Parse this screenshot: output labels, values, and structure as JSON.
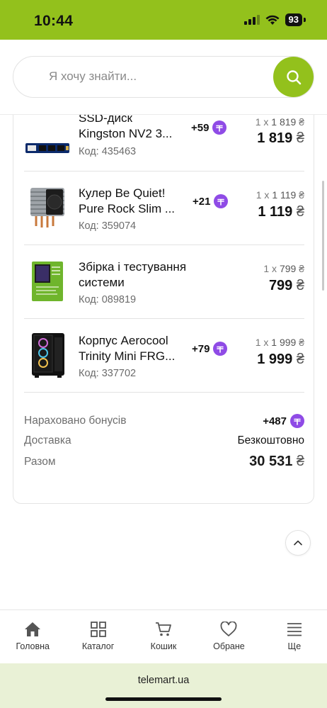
{
  "status_bar": {
    "time": "10:44",
    "battery": "93"
  },
  "search": {
    "placeholder": "Я хочу знайти..."
  },
  "items": [
    {
      "name_line1": "SSD-диск",
      "name_line2": "Kingston NV2 3...",
      "code": "Код: 435463",
      "bonus": "+59",
      "qty_prefix": "1 x",
      "unit_price": "1 819",
      "total": "1 819",
      "currency": "₴"
    },
    {
      "name_line1": "Кулер Be Quiet!",
      "name_line2": "Pure Rock Slim ...",
      "code": "Код: 359074",
      "bonus": "+21",
      "qty_prefix": "1 x",
      "unit_price": "1 119",
      "total": "1 119",
      "currency": "₴"
    },
    {
      "name_line1": "Збірка і тестування",
      "name_line2": "системи",
      "code": "Код: 089819",
      "bonus": "",
      "qty_prefix": "1 x",
      "unit_price": "799",
      "total": "799",
      "currency": "₴"
    },
    {
      "name_line1": "Корпус Aerocool",
      "name_line2": "Trinity Mini FRG...",
      "code": "Код: 337702",
      "bonus": "+79",
      "qty_prefix": "1 x",
      "unit_price": "1 999",
      "total": "1 999",
      "currency": "₴"
    }
  ],
  "summary": {
    "bonus_label": "Нараховано бонусів",
    "bonus_value": "+487",
    "delivery_label": "Доставка",
    "delivery_value": "Безкоштовно",
    "total_label": "Разом",
    "total_value": "30 531",
    "currency": "₴"
  },
  "bottom_nav": [
    {
      "label": "Головна",
      "icon": "home-icon"
    },
    {
      "label": "Каталог",
      "icon": "grid-icon"
    },
    {
      "label": "Кошик",
      "icon": "cart-icon"
    },
    {
      "label": "Обране",
      "icon": "heart-icon"
    },
    {
      "label": "Ще",
      "icon": "menu-icon"
    }
  ],
  "footer": {
    "url": "telemart.ua"
  },
  "colors": {
    "brand_green": "#93c11c",
    "bonus_purple": "#8f4be6",
    "footer_bg": "#e9f1d6"
  }
}
